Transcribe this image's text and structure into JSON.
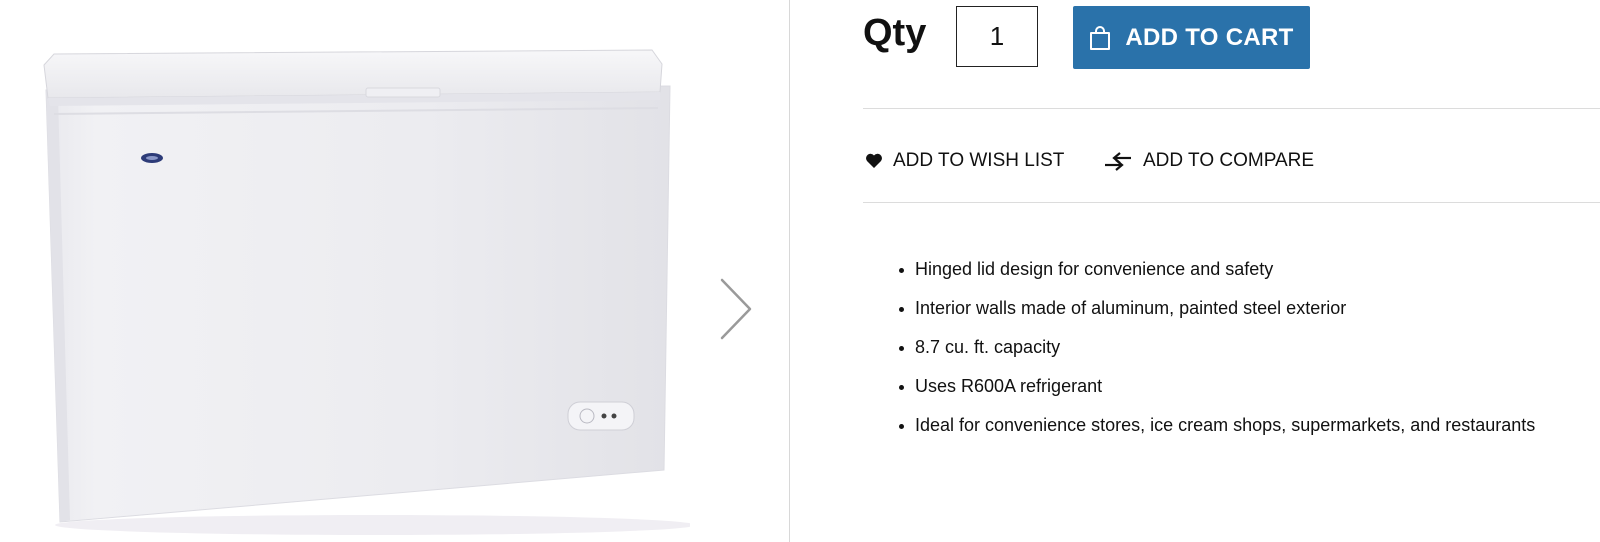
{
  "purchase": {
    "qty_label": "Qty",
    "qty_value": "1",
    "add_to_cart_label": "ADD TO CART",
    "button_color": "#2a72aa"
  },
  "actions": {
    "wishlist_label": "ADD TO WISH LIST",
    "compare_label": "ADD TO COMPARE"
  },
  "features": [
    "Hinged lid design for convenience and safety",
    "Interior walls made of aluminum, painted steel exterior",
    "8.7 cu. ft. capacity",
    "Uses R600A refrigerant",
    "Ideal for convenience stores, ice cream shops, supermarkets, and restaurants"
  ],
  "gallery": {
    "image_subject": "white chest freezer",
    "next_icon": "chevron-right-icon"
  }
}
